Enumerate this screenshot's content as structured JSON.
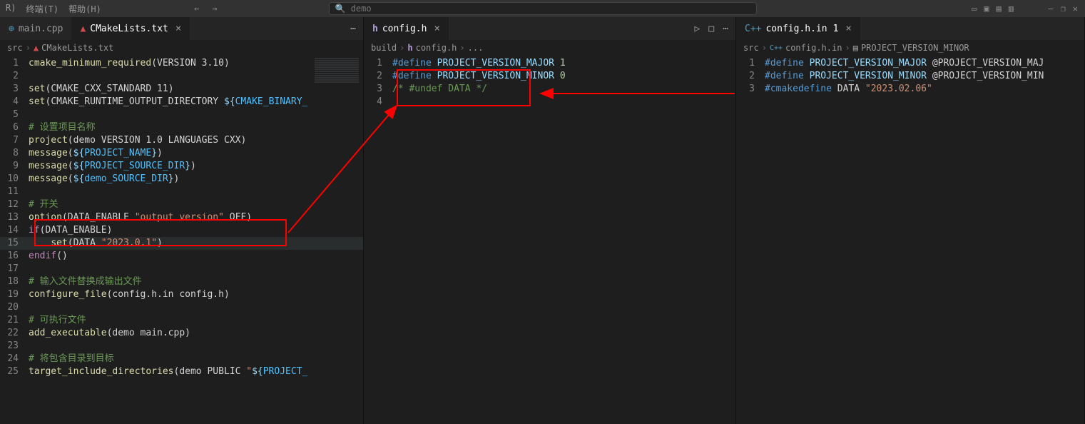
{
  "menubar": {
    "items": [
      "R)",
      "终端(T)",
      "帮助(H)"
    ]
  },
  "search": {
    "prefix_icon": "🔍",
    "placeholder": "demo"
  },
  "title_controls": {
    "layout_icons": [
      "▭",
      "▣",
      "▤",
      "▥"
    ],
    "window": [
      "–",
      "❐",
      "✕"
    ]
  },
  "pane1": {
    "tabs": [
      {
        "icon": "C++",
        "label": "main.cpp",
        "active": false
      },
      {
        "icon": "▲",
        "label": "CMakeLists.txt",
        "active": true
      }
    ],
    "tabs_actions": [
      "⋯"
    ],
    "breadcrumb": [
      "src",
      "CMakeLists.txt"
    ],
    "lines": [
      {
        "n": 1,
        "html": "<span class='fn'>cmake_minimum_required</span><span class='op'>(</span><span class='txt'>VERSION 3.10</span><span class='op'>)</span>"
      },
      {
        "n": 2,
        "html": ""
      },
      {
        "n": 3,
        "html": "<span class='fn'>set</span><span class='op'>(</span><span class='txt'>CMAKE_CXX_STANDARD 11</span><span class='op'>)</span>"
      },
      {
        "n": 4,
        "html": "<span class='fn'>set</span><span class='op'>(</span><span class='txt'>CMAKE_RUNTIME_OUTPUT_DIRECTORY </span><span class='var'>${</span><span class='def'>CMAKE_BINARY_</span>"
      },
      {
        "n": 5,
        "html": ""
      },
      {
        "n": 6,
        "html": "<span class='cmt'># 设置项目名称</span>"
      },
      {
        "n": 7,
        "html": "<span class='fn'>project</span><span class='op'>(</span><span class='txt'>demo VERSION 1.0 LANGUAGES CXX</span><span class='op'>)</span>"
      },
      {
        "n": 8,
        "html": "<span class='fn'>message</span><span class='op'>(</span><span class='var'>${</span><span class='def'>PROJECT_NAME</span><span class='var'>}</span><span class='op'>)</span>"
      },
      {
        "n": 9,
        "html": "<span class='fn'>message</span><span class='op'>(</span><span class='var'>${</span><span class='def'>PROJECT_SOURCE_DIR</span><span class='var'>}</span><span class='op'>)</span>"
      },
      {
        "n": 10,
        "html": "<span class='fn'>message</span><span class='op'>(</span><span class='var'>${</span><span class='def'>demo_SOURCE_DIR</span><span class='var'>}</span><span class='op'>)</span>"
      },
      {
        "n": 11,
        "html": ""
      },
      {
        "n": 12,
        "html": "<span class='cmt'># 开关</span>"
      },
      {
        "n": 13,
        "html": "<span class='fn'>option</span><span class='op'>(</span><span class='txt'>DATA_ENABLE </span><span class='str'>\"output version\"</span><span class='txt'> OFF</span><span class='op'>)</span>"
      },
      {
        "n": 14,
        "html": "<span class='kw'>if</span><span class='op'>(</span><span class='txt'>DATA_ENABLE</span><span class='op'>)</span>"
      },
      {
        "n": 15,
        "html": "    <span class='fn'>set</span><span class='op'>(</span><span class='txt'>DATA </span><span class='str'>\"2023.0.1\"</span><span class='op'>)</span>",
        "hl": true
      },
      {
        "n": 16,
        "html": "<span class='kw'>endif</span><span class='op'>()</span>"
      },
      {
        "n": 17,
        "html": ""
      },
      {
        "n": 18,
        "html": "<span class='cmt'># 输入文件替换成输出文件</span>"
      },
      {
        "n": 19,
        "html": "<span class='fn'>configure_file</span><span class='op'>(</span><span class='txt'>config.h.in config.h</span><span class='op'>)</span>"
      },
      {
        "n": 20,
        "html": ""
      },
      {
        "n": 21,
        "html": "<span class='cmt'># 可执行文件</span>"
      },
      {
        "n": 22,
        "html": "<span class='fn'>add_executable</span><span class='op'>(</span><span class='txt'>demo main.cpp</span><span class='op'>)</span>"
      },
      {
        "n": 23,
        "html": ""
      },
      {
        "n": 24,
        "html": "<span class='cmt'># 将包含目录到目标</span>"
      },
      {
        "n": 25,
        "html": "<span class='fn'>target_include_directories</span><span class='op'>(</span><span class='txt'>demo PUBLIC </span><span class='str'>\"</span><span class='var'>${</span><span class='def'>PROJECT_</span>"
      }
    ]
  },
  "pane2": {
    "tabs": [
      {
        "icon": "h",
        "label": "config.h",
        "active": true
      }
    ],
    "tabs_actions": [
      "▷",
      "□",
      "⋯"
    ],
    "breadcrumb": [
      "build",
      "config.h",
      "..."
    ],
    "lines": [
      {
        "n": 1,
        "html": "<span class='mac'>#define</span> <span class='mvar'>PROJECT_VERSION_MAJOR</span> <span class='num'>1</span>"
      },
      {
        "n": 2,
        "html": "<span class='mac'>#define</span> <span class='mvar'>PROJECT_VERSION_MINOR</span> <span class='num'>0</span>"
      },
      {
        "n": 3,
        "html": "<span class='cmt'>/* #undef DATA */</span>"
      },
      {
        "n": 4,
        "html": ""
      }
    ]
  },
  "pane3": {
    "tabs": [
      {
        "icon": "C++",
        "label": "config.h.in",
        "active": true,
        "modified": "1"
      }
    ],
    "breadcrumb": [
      "src",
      "config.h.in",
      "PROJECT_VERSION_MINOR"
    ],
    "lines": [
      {
        "n": 1,
        "html": "<span class='mac'>#define</span> <span class='mvar'>PROJECT_VERSION_MAJOR</span> <span class='txt'>@PROJECT_VERSION_MAJ</span>"
      },
      {
        "n": 2,
        "html": "<span class='mac'>#define</span> <span class='mvar'>PROJECT_VERSION_MINOR</span> <span class='txt'>@PROJECT_VERSION_MIN</span>"
      },
      {
        "n": 3,
        "html": "<span class='mac'>#cmakedefine</span> <span class='txt'>DATA </span><span class='str'>\"2023.02.06\"</span>"
      }
    ]
  }
}
